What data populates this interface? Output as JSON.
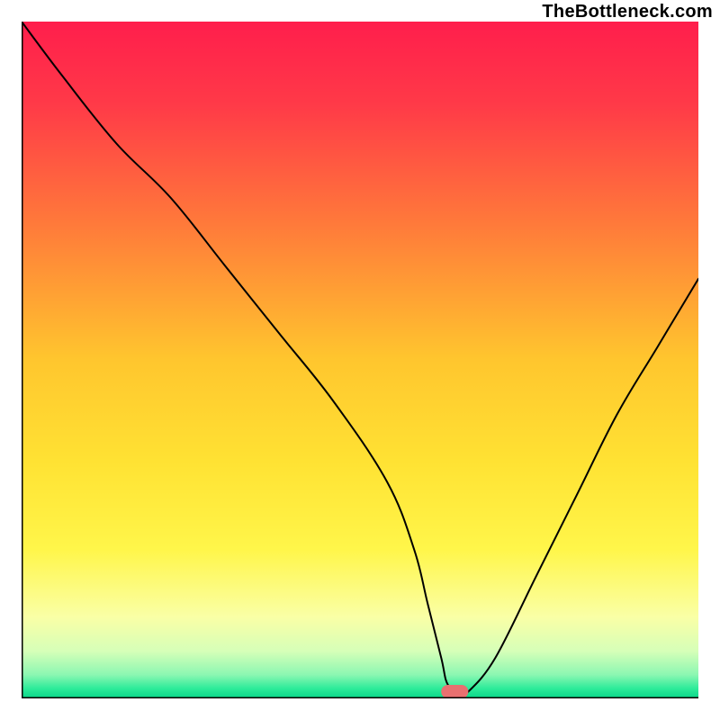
{
  "attribution": "TheBottleneck.com",
  "chart_data": {
    "type": "line",
    "title": "",
    "xlabel": "",
    "ylabel": "",
    "xlim": [
      0,
      100
    ],
    "ylim": [
      0,
      100
    ],
    "series": [
      {
        "name": "bottleneck-curve",
        "x": [
          0,
          6,
          14,
          22,
          30,
          38,
          46,
          54,
          58,
          60,
          62,
          63,
          65,
          66,
          70,
          76,
          82,
          88,
          94,
          100
        ],
        "values": [
          100,
          92,
          82,
          74,
          64,
          54,
          44,
          32,
          22,
          14,
          6,
          2,
          1,
          1,
          6,
          18,
          30,
          42,
          52,
          62
        ]
      }
    ],
    "marker": {
      "name": "optimal-point",
      "x": 64,
      "y": 1,
      "color": "#E87070",
      "width": 4,
      "height": 2
    },
    "gradient_stops": [
      {
        "offset": 0,
        "color": "#FF1E4C"
      },
      {
        "offset": 0.12,
        "color": "#FF3948"
      },
      {
        "offset": 0.3,
        "color": "#FF7A3A"
      },
      {
        "offset": 0.5,
        "color": "#FFC62E"
      },
      {
        "offset": 0.65,
        "color": "#FFE233"
      },
      {
        "offset": 0.78,
        "color": "#FFF64A"
      },
      {
        "offset": 0.88,
        "color": "#FAFFA6"
      },
      {
        "offset": 0.93,
        "color": "#D6FFB8"
      },
      {
        "offset": 0.965,
        "color": "#8CF7B2"
      },
      {
        "offset": 0.985,
        "color": "#2EEB9A"
      },
      {
        "offset": 1.0,
        "color": "#09D688"
      }
    ],
    "axis_color": "#000000",
    "axis_width": 3,
    "curve_color": "#000000",
    "curve_width": 2
  }
}
